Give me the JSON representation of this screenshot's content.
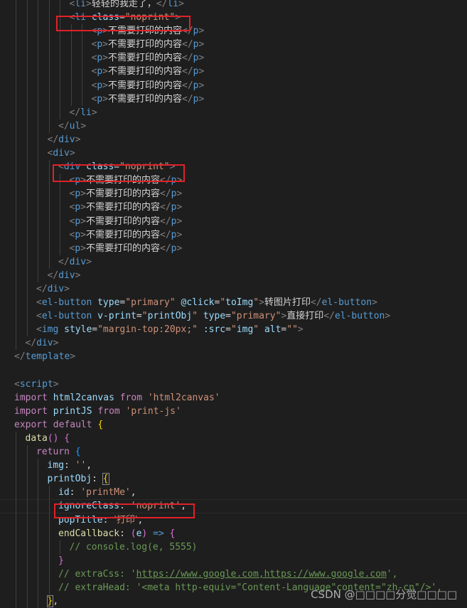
{
  "editor": {
    "language": "vue",
    "highlights": [
      {
        "label": "li class noprint",
        "line": 1
      },
      {
        "label": "div class noprint",
        "line": 12
      },
      {
        "label": "ignoreClass noprint",
        "line": 37
      }
    ],
    "lines": [
      {
        "indent": 6,
        "tokens": [
          [
            "punct",
            "<"
          ],
          [
            "tag",
            "li"
          ],
          [
            "punct",
            ">"
          ],
          [
            "txtw cjk",
            "轻轻的我走了，"
          ],
          [
            "punct",
            "</"
          ],
          [
            "tag",
            "li"
          ],
          [
            "punct",
            ">"
          ]
        ]
      },
      {
        "indent": 6,
        "tokens": [
          [
            "punct",
            "<"
          ],
          [
            "tag",
            "li"
          ],
          [
            "txtw",
            " "
          ],
          [
            "attr",
            "class"
          ],
          [
            "txtw",
            "="
          ],
          [
            "str",
            "\"noprint\""
          ],
          [
            "punct",
            ">"
          ]
        ]
      },
      {
        "indent": 8,
        "tokens": [
          [
            "punct",
            "<"
          ],
          [
            "tag",
            "p"
          ],
          [
            "punct",
            ">"
          ],
          [
            "txtw cjk",
            "不需要打印的内容"
          ],
          [
            "punct",
            "</"
          ],
          [
            "tag",
            "p"
          ],
          [
            "punct",
            ">"
          ]
        ]
      },
      {
        "indent": 8,
        "tokens": [
          [
            "punct",
            "<"
          ],
          [
            "tag",
            "p"
          ],
          [
            "punct",
            ">"
          ],
          [
            "txtw cjk",
            "不需要打印的内容"
          ],
          [
            "punct",
            "</"
          ],
          [
            "tag",
            "p"
          ],
          [
            "punct",
            ">"
          ]
        ]
      },
      {
        "indent": 8,
        "tokens": [
          [
            "punct",
            "<"
          ],
          [
            "tag",
            "p"
          ],
          [
            "punct",
            ">"
          ],
          [
            "txtw cjk",
            "不需要打印的内容"
          ],
          [
            "punct",
            "</"
          ],
          [
            "tag",
            "p"
          ],
          [
            "punct",
            ">"
          ]
        ]
      },
      {
        "indent": 8,
        "tokens": [
          [
            "punct",
            "<"
          ],
          [
            "tag",
            "p"
          ],
          [
            "punct",
            ">"
          ],
          [
            "txtw cjk",
            "不需要打印的内容"
          ],
          [
            "punct",
            "</"
          ],
          [
            "tag",
            "p"
          ],
          [
            "punct",
            ">"
          ]
        ]
      },
      {
        "indent": 8,
        "tokens": [
          [
            "punct",
            "<"
          ],
          [
            "tag",
            "p"
          ],
          [
            "punct",
            ">"
          ],
          [
            "txtw cjk",
            "不需要打印的内容"
          ],
          [
            "punct",
            "</"
          ],
          [
            "tag",
            "p"
          ],
          [
            "punct",
            ">"
          ]
        ]
      },
      {
        "indent": 8,
        "tokens": [
          [
            "punct",
            "<"
          ],
          [
            "tag",
            "p"
          ],
          [
            "punct",
            ">"
          ],
          [
            "txtw cjk",
            "不需要打印的内容"
          ],
          [
            "punct",
            "</"
          ],
          [
            "tag",
            "p"
          ],
          [
            "punct",
            ">"
          ]
        ]
      },
      {
        "indent": 6,
        "tokens": [
          [
            "punct",
            "</"
          ],
          [
            "tag",
            "li"
          ],
          [
            "punct",
            ">"
          ]
        ]
      },
      {
        "indent": 5,
        "tokens": [
          [
            "punct",
            "</"
          ],
          [
            "tag",
            "ul"
          ],
          [
            "punct",
            ">"
          ]
        ]
      },
      {
        "indent": 4,
        "tokens": [
          [
            "punct",
            "</"
          ],
          [
            "tag",
            "div"
          ],
          [
            "punct",
            ">"
          ]
        ]
      },
      {
        "indent": 4,
        "tokens": [
          [
            "punct",
            "<"
          ],
          [
            "tag",
            "div"
          ],
          [
            "punct",
            ">"
          ]
        ]
      },
      {
        "indent": 5,
        "tokens": [
          [
            "punct",
            "<"
          ],
          [
            "tag",
            "div"
          ],
          [
            "txtw",
            " "
          ],
          [
            "attr",
            "class"
          ],
          [
            "txtw",
            "="
          ],
          [
            "str",
            "\"noprint\""
          ],
          [
            "punct",
            ">"
          ]
        ]
      },
      {
        "indent": 6,
        "tokens": [
          [
            "punct",
            "<"
          ],
          [
            "tag",
            "p"
          ],
          [
            "punct",
            ">"
          ],
          [
            "txtw cjk",
            "不需要打印的内容"
          ],
          [
            "punct",
            "</"
          ],
          [
            "tag",
            "p"
          ],
          [
            "punct",
            ">"
          ]
        ]
      },
      {
        "indent": 6,
        "tokens": [
          [
            "punct",
            "<"
          ],
          [
            "tag",
            "p"
          ],
          [
            "punct",
            ">"
          ],
          [
            "txtw cjk",
            "不需要打印的内容"
          ],
          [
            "punct",
            "</"
          ],
          [
            "tag",
            "p"
          ],
          [
            "punct",
            ">"
          ]
        ]
      },
      {
        "indent": 6,
        "tokens": [
          [
            "punct",
            "<"
          ],
          [
            "tag",
            "p"
          ],
          [
            "punct",
            ">"
          ],
          [
            "txtw cjk",
            "不需要打印的内容"
          ],
          [
            "punct",
            "</"
          ],
          [
            "tag",
            "p"
          ],
          [
            "punct",
            ">"
          ]
        ]
      },
      {
        "indent": 6,
        "tokens": [
          [
            "punct",
            "<"
          ],
          [
            "tag",
            "p"
          ],
          [
            "punct",
            ">"
          ],
          [
            "txtw cjk",
            "不需要打印的内容"
          ],
          [
            "punct",
            "</"
          ],
          [
            "tag",
            "p"
          ],
          [
            "punct",
            ">"
          ]
        ]
      },
      {
        "indent": 6,
        "tokens": [
          [
            "punct",
            "<"
          ],
          [
            "tag",
            "p"
          ],
          [
            "punct",
            ">"
          ],
          [
            "txtw cjk",
            "不需要打印的内容"
          ],
          [
            "punct",
            "</"
          ],
          [
            "tag",
            "p"
          ],
          [
            "punct",
            ">"
          ]
        ]
      },
      {
        "indent": 6,
        "tokens": [
          [
            "punct",
            "<"
          ],
          [
            "tag",
            "p"
          ],
          [
            "punct",
            ">"
          ],
          [
            "txtw cjk",
            "不需要打印的内容"
          ],
          [
            "punct",
            "</"
          ],
          [
            "tag",
            "p"
          ],
          [
            "punct",
            ">"
          ]
        ]
      },
      {
        "indent": 5,
        "tokens": [
          [
            "punct",
            "</"
          ],
          [
            "tag",
            "div"
          ],
          [
            "punct",
            ">"
          ]
        ]
      },
      {
        "indent": 4,
        "tokens": [
          [
            "punct",
            "</"
          ],
          [
            "tag",
            "div"
          ],
          [
            "punct",
            ">"
          ]
        ]
      },
      {
        "indent": 3,
        "tokens": [
          [
            "punct",
            "</"
          ],
          [
            "tag",
            "div"
          ],
          [
            "punct",
            ">"
          ]
        ]
      },
      {
        "indent": 3,
        "tokens": [
          [
            "punct",
            "<"
          ],
          [
            "tag",
            "el-button"
          ],
          [
            "txtw",
            " "
          ],
          [
            "attr",
            "type"
          ],
          [
            "txtw",
            "="
          ],
          [
            "str",
            "\"primary\""
          ],
          [
            "txtw",
            " "
          ],
          [
            "attr",
            "@click"
          ],
          [
            "txtw",
            "="
          ],
          [
            "str",
            "\""
          ],
          [
            "attr",
            "toImg"
          ],
          [
            "str",
            "\""
          ],
          [
            "punct",
            ">"
          ],
          [
            "txtw cjk",
            "转图片打印"
          ],
          [
            "punct",
            "</"
          ],
          [
            "tag",
            "el-button"
          ],
          [
            "punct",
            ">"
          ]
        ]
      },
      {
        "indent": 3,
        "tokens": [
          [
            "punct",
            "<"
          ],
          [
            "tag",
            "el-button"
          ],
          [
            "txtw",
            " "
          ],
          [
            "attr",
            "v-print"
          ],
          [
            "txtw",
            "="
          ],
          [
            "str",
            "\""
          ],
          [
            "attr",
            "printObj"
          ],
          [
            "str",
            "\""
          ],
          [
            "txtw",
            " "
          ],
          [
            "attr",
            "type"
          ],
          [
            "txtw",
            "="
          ],
          [
            "str",
            "\"primary\""
          ],
          [
            "punct",
            ">"
          ],
          [
            "txtw cjk",
            "直接打印"
          ],
          [
            "punct",
            "</"
          ],
          [
            "tag",
            "el-button"
          ],
          [
            "punct",
            ">"
          ]
        ]
      },
      {
        "indent": 3,
        "tokens": [
          [
            "punct",
            "<"
          ],
          [
            "tag",
            "img"
          ],
          [
            "txtw",
            " "
          ],
          [
            "attr",
            "style"
          ],
          [
            "txtw",
            "="
          ],
          [
            "str",
            "\"margin-top:20px;\""
          ],
          [
            "txtw",
            " "
          ],
          [
            "attr",
            ":src"
          ],
          [
            "txtw",
            "="
          ],
          [
            "str",
            "\""
          ],
          [
            "attr",
            "img"
          ],
          [
            "str",
            "\""
          ],
          [
            "txtw",
            " "
          ],
          [
            "attr",
            "alt"
          ],
          [
            "txtw",
            "="
          ],
          [
            "str",
            "\"\""
          ],
          [
            "punct",
            ">"
          ]
        ]
      },
      {
        "indent": 2,
        "tokens": [
          [
            "punct",
            "</"
          ],
          [
            "tag",
            "div"
          ],
          [
            "punct",
            ">"
          ]
        ]
      },
      {
        "indent": 1,
        "tokens": [
          [
            "punct",
            "</"
          ],
          [
            "tag",
            "template"
          ],
          [
            "punct",
            ">"
          ]
        ]
      },
      {
        "indent": 1,
        "tokens": []
      },
      {
        "indent": 1,
        "tokens": [
          [
            "punct",
            "<"
          ],
          [
            "tag",
            "script"
          ],
          [
            "punct",
            ">"
          ]
        ]
      },
      {
        "indent": 1,
        "tokens": [
          [
            "kw",
            "import"
          ],
          [
            "txtw",
            " "
          ],
          [
            "var",
            "html2canvas"
          ],
          [
            "txtw",
            " "
          ],
          [
            "kw",
            "from"
          ],
          [
            "txtw",
            " "
          ],
          [
            "str",
            "'html2canvas'"
          ]
        ]
      },
      {
        "indent": 1,
        "tokens": [
          [
            "kw",
            "import"
          ],
          [
            "txtw",
            " "
          ],
          [
            "var",
            "printJS"
          ],
          [
            "txtw",
            " "
          ],
          [
            "kw",
            "from"
          ],
          [
            "txtw",
            " "
          ],
          [
            "str",
            "'print-js'"
          ]
        ]
      },
      {
        "indent": 1,
        "tokens": [
          [
            "kw",
            "export"
          ],
          [
            "txtw",
            " "
          ],
          [
            "kw",
            "default"
          ],
          [
            "txtw",
            " "
          ],
          [
            "brace",
            "{"
          ]
        ]
      },
      {
        "indent": 2,
        "tokens": [
          [
            "fn",
            "data"
          ],
          [
            "brace2",
            "()"
          ],
          [
            "txtw",
            " "
          ],
          [
            "brace2",
            "{"
          ]
        ]
      },
      {
        "indent": 3,
        "tokens": [
          [
            "kw",
            "return"
          ],
          [
            "txtw",
            " "
          ],
          [
            "brace3",
            "{"
          ]
        ]
      },
      {
        "indent": 4,
        "tokens": [
          [
            "var",
            "img"
          ],
          [
            "txtw",
            ": "
          ],
          [
            "str",
            "''"
          ],
          [
            "txtw",
            ","
          ]
        ]
      },
      {
        "indent": 4,
        "tokens": [
          [
            "var",
            "printObj"
          ],
          [
            "txtw",
            ": "
          ],
          [
            "brace match",
            "{"
          ]
        ]
      },
      {
        "indent": 5,
        "tokens": [
          [
            "var",
            "id"
          ],
          [
            "txtw",
            ": "
          ],
          [
            "str",
            "'printMe'"
          ],
          [
            "txtw",
            ","
          ]
        ]
      },
      {
        "indent": 5,
        "current": true,
        "tokens": [
          [
            "var",
            "ignoreClass"
          ],
          [
            "txtw",
            ": "
          ],
          [
            "str",
            "'noprint'"
          ],
          [
            "txtw",
            ","
          ]
        ]
      },
      {
        "indent": 5,
        "tokens": [
          [
            "var",
            "popTitle"
          ],
          [
            "txtw",
            ": "
          ],
          [
            "str cjk",
            "'打印'"
          ],
          [
            "txtw",
            ","
          ]
        ]
      },
      {
        "indent": 5,
        "tokens": [
          [
            "fn",
            "endCallback"
          ],
          [
            "txtw",
            ": "
          ],
          [
            "brace2",
            "("
          ],
          [
            "var",
            "e"
          ],
          [
            "brace2",
            ")"
          ],
          [
            "txtw",
            " "
          ],
          [
            "kw2",
            "=>"
          ],
          [
            "txtw",
            " "
          ],
          [
            "brace2",
            "{"
          ]
        ]
      },
      {
        "indent": 6,
        "tokens": [
          [
            "cmt",
            "// console.log(e, 5555)"
          ]
        ]
      },
      {
        "indent": 5,
        "tokens": [
          [
            "brace2",
            "}"
          ]
        ]
      },
      {
        "indent": 5,
        "tokens": [
          [
            "cmt",
            "// extraCss: '"
          ],
          [
            "cmt-link",
            "https://www.google.com,https://www.google.com"
          ],
          [
            "cmt",
            "',"
          ]
        ]
      },
      {
        "indent": 5,
        "tokens": [
          [
            "cmt",
            "// extraHead: '<meta http-equiv=\"Content-Language\"content=\"zh-cn\"/>',"
          ]
        ]
      },
      {
        "indent": 4,
        "tokens": [
          [
            "brace match",
            "}"
          ],
          [
            "txtw",
            ","
          ]
        ]
      }
    ]
  },
  "watermark": "CSDN @□□□□分觉□□□□"
}
